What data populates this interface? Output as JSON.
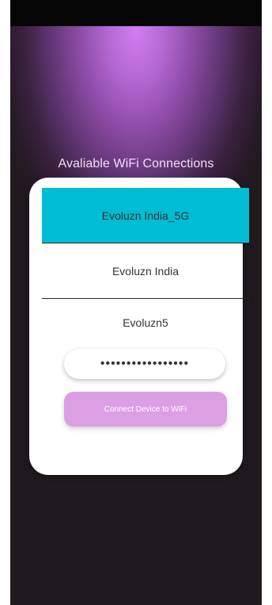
{
  "heading": "Avaliable WiFi Connections",
  "networks": [
    {
      "ssid": "Evoluzn India_5G",
      "selected": true
    },
    {
      "ssid": "Evoluzn India",
      "selected": false
    },
    {
      "ssid": "Evoluzn5",
      "selected": false
    }
  ],
  "password": {
    "value": "•••••••••••••••••"
  },
  "connect_button": {
    "label": "Connect Device to WiFi"
  },
  "colors": {
    "selected_network_bg": "#00bcd4",
    "accent_button": "#dd9fe3",
    "gradient_top": "#d27df0",
    "background_dark": "#201a1e"
  }
}
